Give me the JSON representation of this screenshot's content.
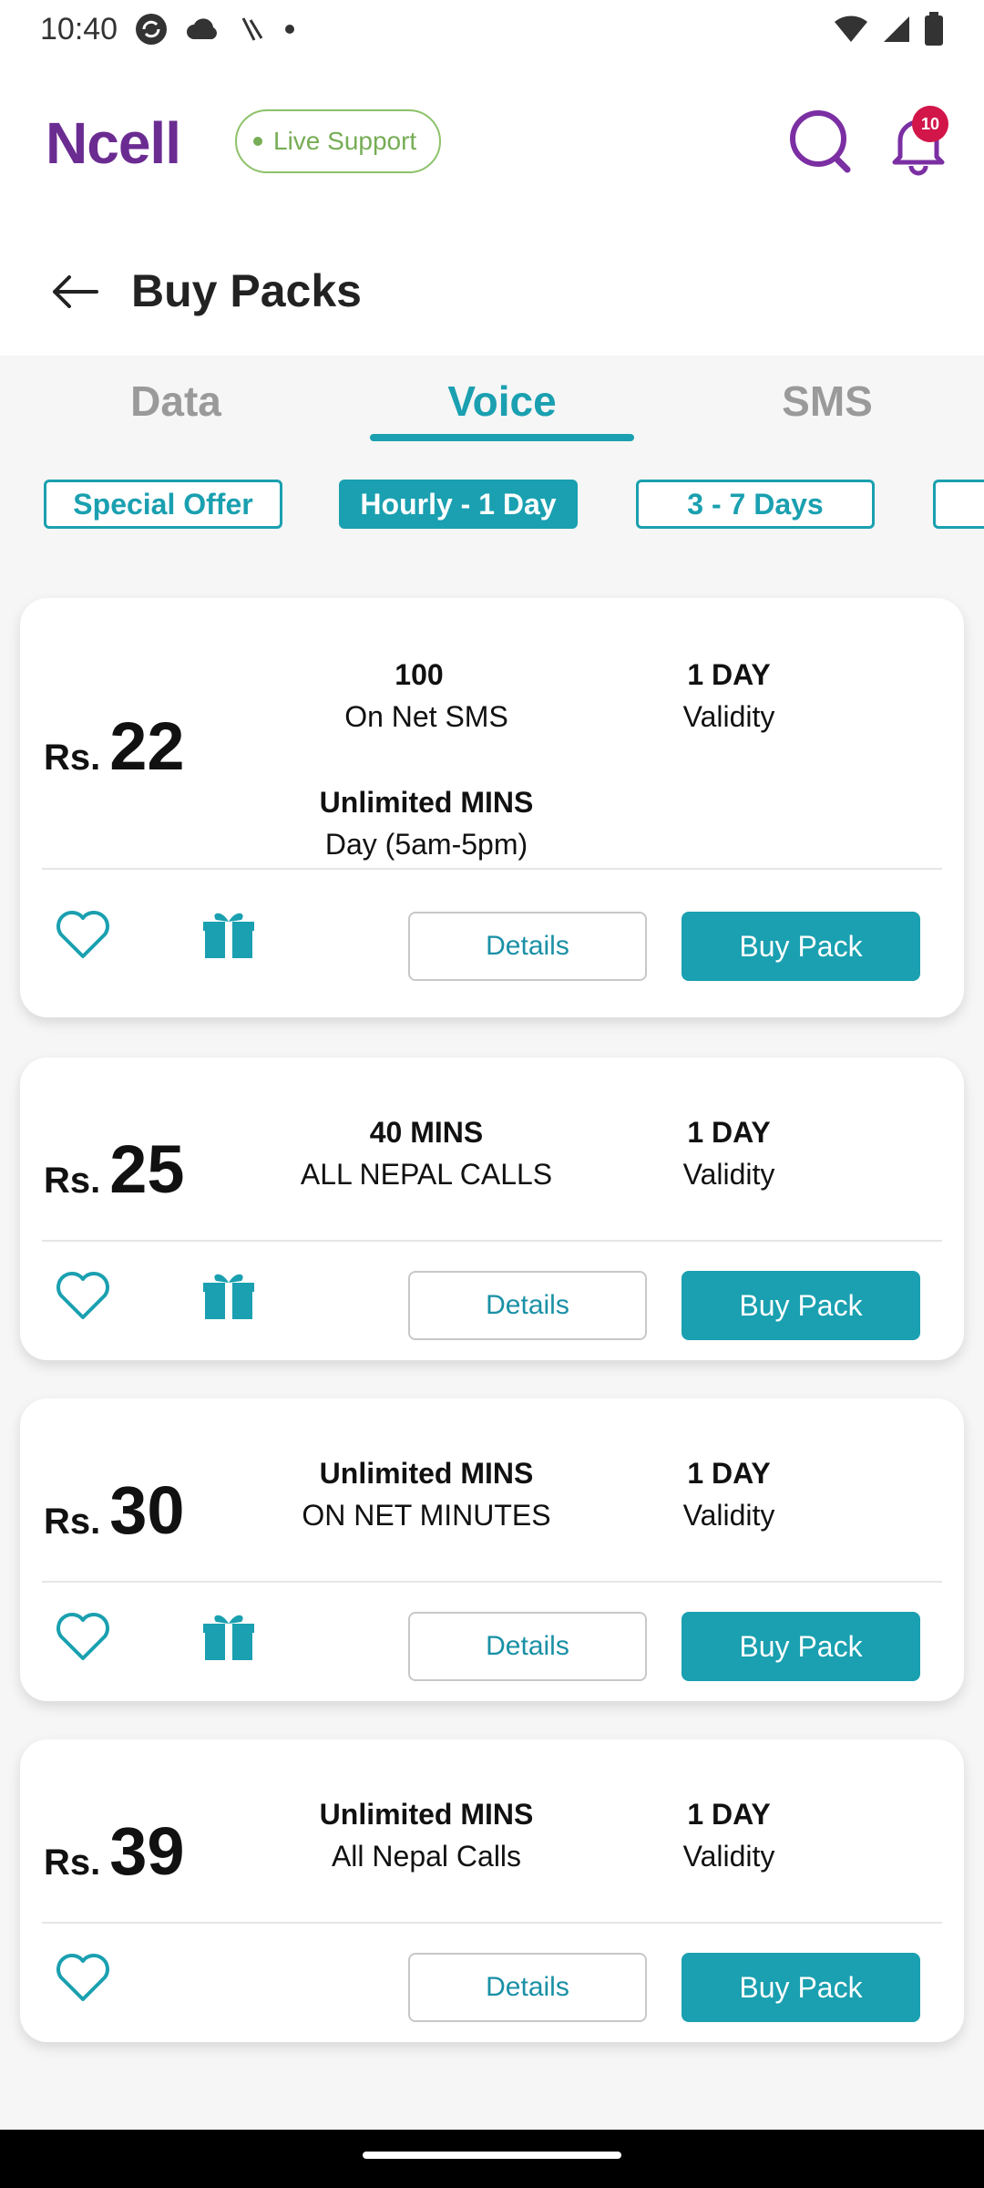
{
  "status_bar": {
    "time": "10:40"
  },
  "header": {
    "logo": "Ncell",
    "live_support": "Live Support",
    "notification_count": "10"
  },
  "page": {
    "title": "Buy Packs"
  },
  "tabs": [
    {
      "label": "Data"
    },
    {
      "label": "Voice"
    },
    {
      "label": "SMS"
    }
  ],
  "active_tab": "Voice",
  "filters": [
    {
      "label": "Special Offer"
    },
    {
      "label": "Hourly - 1 Day"
    },
    {
      "label": "3 - 7 Days"
    }
  ],
  "active_filter": "Hourly - 1 Day",
  "packs": [
    {
      "currency": "Rs.",
      "price": "22",
      "benefit1_title": "100",
      "benefit1_sub": "On Net SMS",
      "validity_title": "1 DAY",
      "validity_sub": "Validity",
      "benefit2_title": "Unlimited MINS",
      "benefit2_sub": "Day (5am-5pm)",
      "details_label": "Details",
      "buy_label": "Buy Pack"
    },
    {
      "currency": "Rs.",
      "price": "25",
      "benefit1_title": "40 MINS",
      "benefit1_sub": "ALL NEPAL CALLS",
      "validity_title": "1 DAY",
      "validity_sub": "Validity",
      "details_label": "Details",
      "buy_label": "Buy Pack"
    },
    {
      "currency": "Rs.",
      "price": "30",
      "benefit1_title": "Unlimited MINS",
      "benefit1_sub": "ON NET MINUTES",
      "validity_title": "1 DAY",
      "validity_sub": "Validity",
      "details_label": "Details",
      "buy_label": "Buy Pack"
    },
    {
      "currency": "Rs.",
      "price": "39",
      "benefit1_title": "Unlimited MINS",
      "benefit1_sub": "All Nepal Calls",
      "validity_title": "1 DAY",
      "validity_sub": "Validity",
      "details_label": "Details",
      "buy_label": "Buy Pack"
    }
  ],
  "colors": {
    "brand_purple": "#6b2c91",
    "accent_teal": "#1aa0b0",
    "live_green": "#76ad55",
    "badge_red": "#d2164a"
  }
}
